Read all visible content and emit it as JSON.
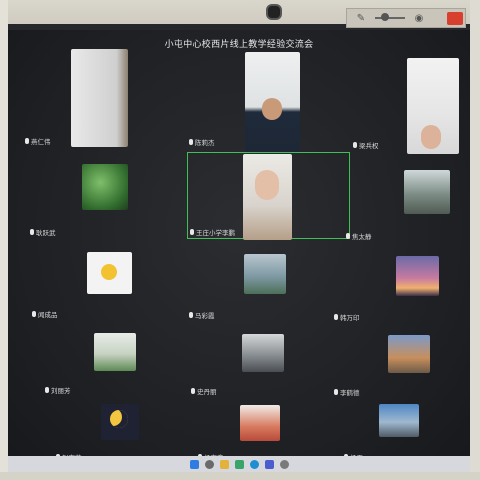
{
  "meeting": {
    "title": "小屯中心校西片线上教学经验交流会"
  },
  "toolbar": {
    "icons": [
      "pen-off-icon",
      "slider-icon",
      "camera-icon",
      "close-icon"
    ]
  },
  "participants": [
    {
      "name": "燕仁伟",
      "muted": true
    },
    {
      "name": "陈莉杰",
      "muted": true
    },
    {
      "name": "梁兵权",
      "muted": true
    },
    {
      "name": "王庄小学李鹏",
      "muted": false,
      "active": true
    },
    {
      "name": "耿跃武",
      "muted": true
    },
    {
      "name": "焦太静",
      "muted": true
    },
    {
      "name": "闻成品",
      "muted": true
    },
    {
      "name": "马彩霞",
      "muted": true
    },
    {
      "name": "韩万印",
      "muted": true
    },
    {
      "name": "刘丽芳",
      "muted": true
    },
    {
      "name": "史丹丽",
      "muted": true
    },
    {
      "name": "李鹤德",
      "muted": true
    },
    {
      "name": "赵志芬",
      "muted": true
    },
    {
      "name": "杨志鑫",
      "muted": true
    },
    {
      "name": "杨玉",
      "muted": true
    }
  ],
  "taskbar": {
    "icons": [
      "windows-icon",
      "search-icon",
      "files-icon",
      "chat-icon",
      "edge-icon",
      "store-icon",
      "settings-icon"
    ]
  }
}
